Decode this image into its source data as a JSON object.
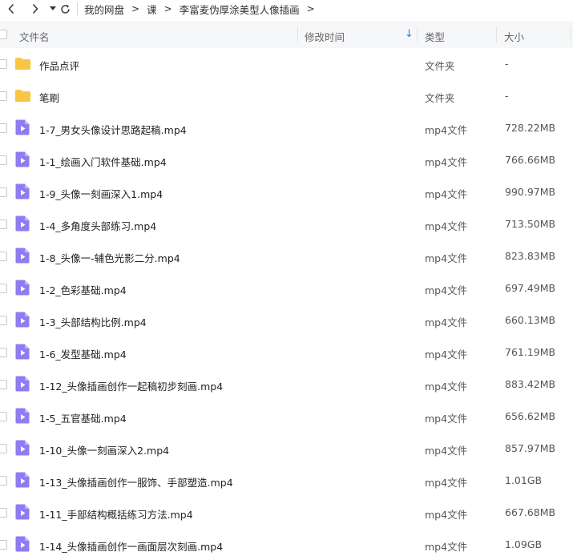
{
  "breadcrumb": {
    "items": [
      "我的网盘",
      "课",
      "李富麦伪厚涂美型人像插画"
    ]
  },
  "columns": {
    "name": "文件名",
    "modified": "修改时间",
    "type": "类型",
    "size": "大小"
  },
  "files": [
    {
      "icon": "folder-icon",
      "name": "作品点评",
      "type": "文件夹",
      "size": "-"
    },
    {
      "icon": "folder-icon",
      "name": "笔刷",
      "type": "文件夹",
      "size": "-"
    },
    {
      "icon": "video-file-icon",
      "name": "1-7_男女头像设计思路起稿.mp4",
      "type": "mp4文件",
      "size": "728.22MB"
    },
    {
      "icon": "video-file-icon",
      "name": "1-1_绘画入门软件基础.mp4",
      "type": "mp4文件",
      "size": "766.66MB"
    },
    {
      "icon": "video-file-icon",
      "name": "1-9_头像一刻画深入1.mp4",
      "type": "mp4文件",
      "size": "990.97MB"
    },
    {
      "icon": "video-file-icon",
      "name": "1-4_多角度头部练习.mp4",
      "type": "mp4文件",
      "size": "713.50MB"
    },
    {
      "icon": "video-file-icon",
      "name": "1-8_头像一-辅色光影二分.mp4",
      "type": "mp4文件",
      "size": "823.83MB"
    },
    {
      "icon": "video-file-icon",
      "name": "1-2_色彩基础.mp4",
      "type": "mp4文件",
      "size": "697.49MB"
    },
    {
      "icon": "video-file-icon",
      "name": "1-3_头部结构比例.mp4",
      "type": "mp4文件",
      "size": "660.13MB"
    },
    {
      "icon": "video-file-icon",
      "name": "1-6_发型基础.mp4",
      "type": "mp4文件",
      "size": "761.19MB"
    },
    {
      "icon": "video-file-icon",
      "name": "1-12_头像插画创作一起稿初步刻画.mp4",
      "type": "mp4文件",
      "size": "883.42MB"
    },
    {
      "icon": "video-file-icon",
      "name": "1-5_五官基础.mp4",
      "type": "mp4文件",
      "size": "656.62MB"
    },
    {
      "icon": "video-file-icon",
      "name": "1-10_头像一刻画深入2.mp4",
      "type": "mp4文件",
      "size": "857.97MB"
    },
    {
      "icon": "video-file-icon",
      "name": "1-13_头像插画创作一服饰、手部塑造.mp4",
      "type": "mp4文件",
      "size": "1.01GB"
    },
    {
      "icon": "video-file-icon",
      "name": "1-11_手部结构概括练习方法.mp4",
      "type": "mp4文件",
      "size": "667.68MB"
    },
    {
      "icon": "video-file-icon",
      "name": "1-14_头像插画创作一画面层次刻画.mp4",
      "type": "mp4文件",
      "size": "1.09GB"
    }
  ],
  "colors": {
    "folder": "#f7c744",
    "video_file": "#8f7cf0",
    "sort_arrow": "#2b7ff0",
    "header_bg": "#f6f7f9"
  }
}
